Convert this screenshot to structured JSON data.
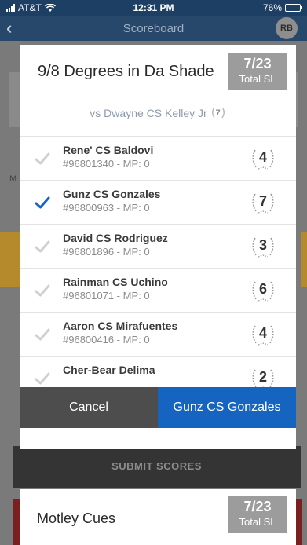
{
  "status_bar": {
    "carrier": "AT&T",
    "time": "12:31 PM",
    "battery": "76%"
  },
  "nav": {
    "title": "Scoreboard",
    "avatar": "RB"
  },
  "background": {
    "tab_letter": "M",
    "submit_label": "SUBMIT SCORES"
  },
  "modal": {
    "match_title": "9/8 Degrees in Da Shade",
    "total_sl_value": "7/23",
    "total_sl_label": "Total SL",
    "opponent_text": "vs Dwayne CS Kelley Jr",
    "opponent_skill": "7",
    "players": [
      {
        "name": "Rene' CS Baldovi",
        "meta": "#96801340 - MP: 0",
        "skill": "4",
        "selected": false
      },
      {
        "name": "Gunz CS Gonzales",
        "meta": "#96800963 - MP: 0",
        "skill": "7",
        "selected": true
      },
      {
        "name": "David CS Rodriguez",
        "meta": "#96801896 - MP: 0",
        "skill": "3",
        "selected": false
      },
      {
        "name": "Rainman CS Uchino",
        "meta": "#96801071 - MP: 0",
        "skill": "6",
        "selected": false
      },
      {
        "name": "Aaron CS Mirafuentes",
        "meta": "#96800416 - MP: 0",
        "skill": "4",
        "selected": false
      },
      {
        "name": "Cher-Bear Delima",
        "meta": "",
        "skill": "2",
        "selected": false
      }
    ],
    "cancel_label": "Cancel",
    "confirm_label": "Gunz CS Gonzales"
  },
  "card2": {
    "team_name": "Motley Cues",
    "total_sl_value": "7/23",
    "total_sl_label": "Total SL"
  },
  "colors": {
    "accent": "#1565c0",
    "check_selected": "#1565c0",
    "check_unselected": "#d0d0d0",
    "cancel_bg": "#4d4d4d"
  }
}
